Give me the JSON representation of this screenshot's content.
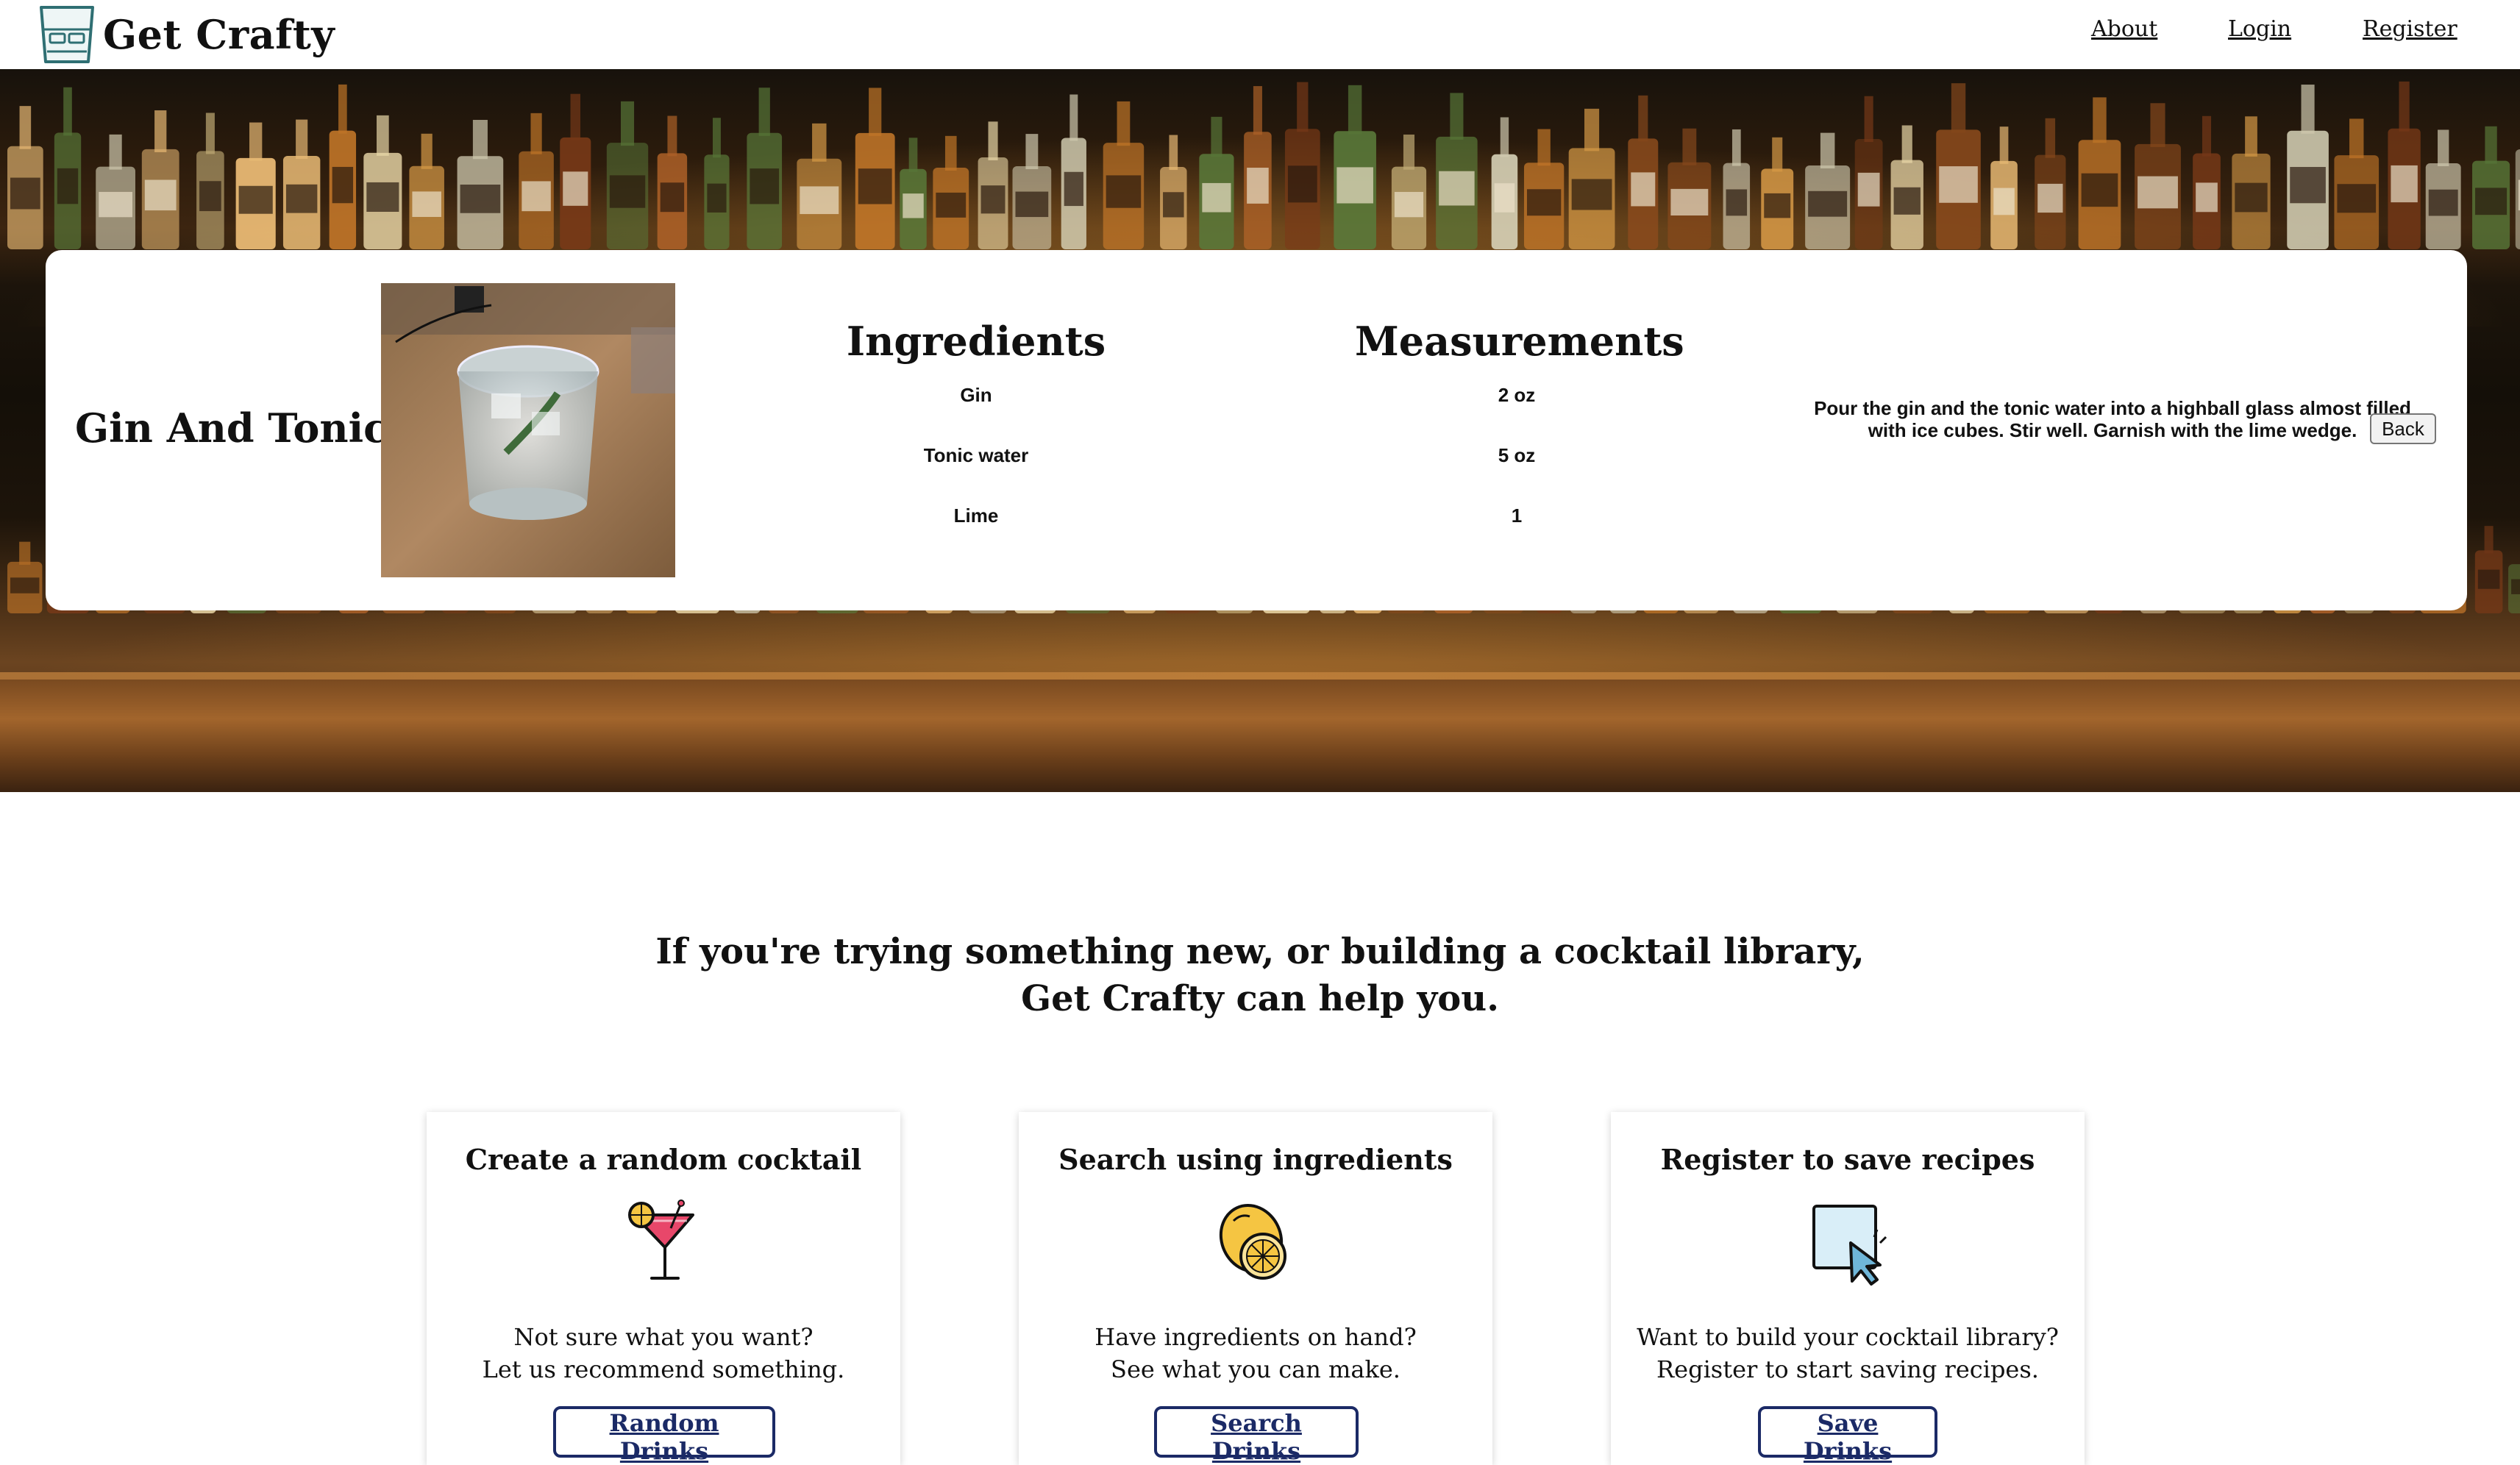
{
  "nav": {
    "brand": "Get Crafty",
    "links": [
      {
        "label": "About"
      },
      {
        "label": "Login"
      },
      {
        "label": "Register"
      }
    ]
  },
  "recipe": {
    "name": "Gin And Tonic",
    "ingredients_heading": "Ingredients",
    "measurements_heading": "Measurements",
    "ingredients": [
      {
        "name": "Gin",
        "measure": "2 oz"
      },
      {
        "name": "Tonic water",
        "measure": "5 oz"
      },
      {
        "name": "Lime",
        "measure": "1"
      }
    ],
    "instructions": "Pour the gin and the tonic water into a highball glass almost filled with ice cubes. Stir well. Garnish with the lime wedge.",
    "back_label": "Back"
  },
  "pitch": {
    "line1": "If you're trying something new, or building a cocktail library,",
    "line2": "Get Crafty can help you."
  },
  "features": [
    {
      "title": "Create a random cocktail",
      "icon": "cocktail-glass-icon",
      "desc1": "Not sure what you want?",
      "desc2": "Let us recommend something.",
      "button": "Random Drinks"
    },
    {
      "title": "Search using ingredients",
      "icon": "lemon-icon",
      "desc1": "Have ingredients on hand?",
      "desc2": "See what you can make.",
      "button": "Search Drinks"
    },
    {
      "title": "Register to save recipes",
      "icon": "cursor-click-icon",
      "desc1": "Want to build your cocktail library?",
      "desc2": "Register to start saving recipes.",
      "button": "Save Drinks"
    }
  ],
  "colors": {
    "button_border": "#1b2a66",
    "logo_stroke": "#2f6f73"
  }
}
